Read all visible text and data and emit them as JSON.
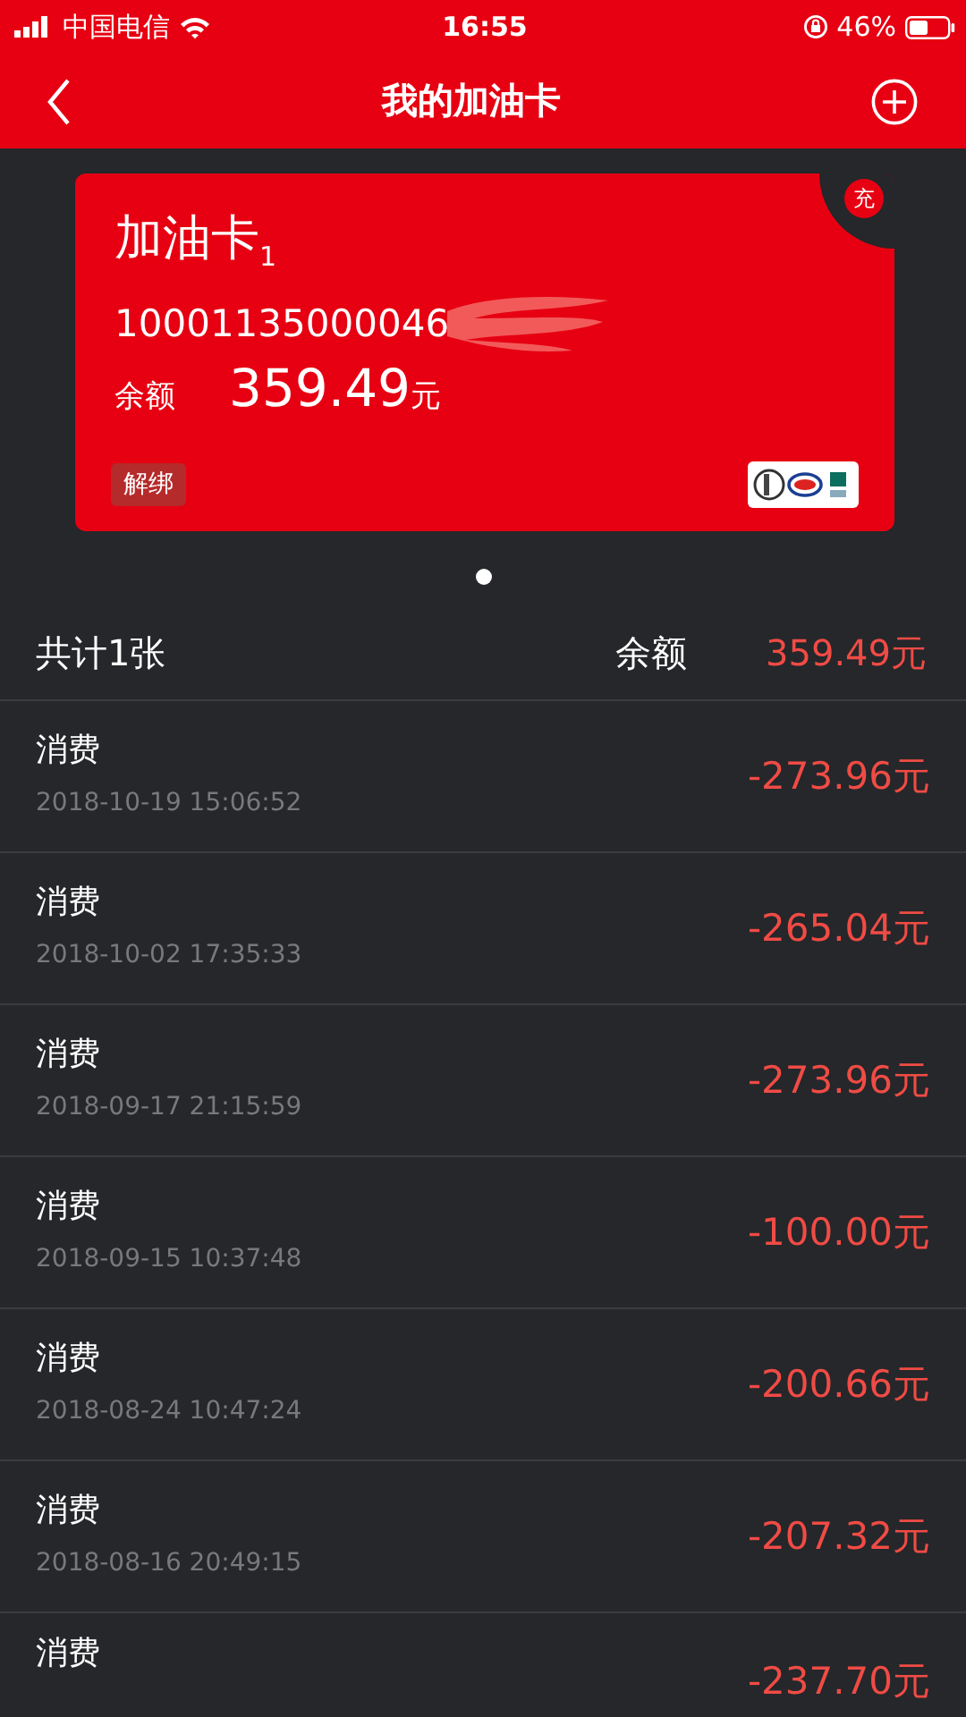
{
  "status_bar": {
    "carrier": "中国电信",
    "time": "16:55",
    "battery": "46%"
  },
  "nav": {
    "title": "我的加油卡"
  },
  "card": {
    "name": "加油卡",
    "index": "1",
    "number": "10001135000046",
    "balance_label": "余额",
    "balance": "359.49",
    "unit": "元",
    "unbind": "解绑",
    "recharge": "充"
  },
  "pager": [
    {
      "selected": true
    }
  ],
  "summary": {
    "count": "共计1张",
    "balance_label": "余额",
    "balance": "359.49元"
  },
  "transactions": [
    {
      "type": "消费",
      "time": "2018-10-19 15:06:52",
      "amount": "-273.96元"
    },
    {
      "type": "消费",
      "time": "2018-10-02 17:35:33",
      "amount": "-265.04元"
    },
    {
      "type": "消费",
      "time": "2018-09-17 21:15:59",
      "amount": "-273.96元"
    },
    {
      "type": "消费",
      "time": "2018-09-15 10:37:48",
      "amount": "-100.00元"
    },
    {
      "type": "消费",
      "time": "2018-08-24 10:47:24",
      "amount": "-200.66元"
    },
    {
      "type": "消费",
      "time": "2018-08-16 20:49:15",
      "amount": "-207.32元"
    },
    {
      "type": "消费",
      "amount": "-237.70元"
    }
  ]
}
